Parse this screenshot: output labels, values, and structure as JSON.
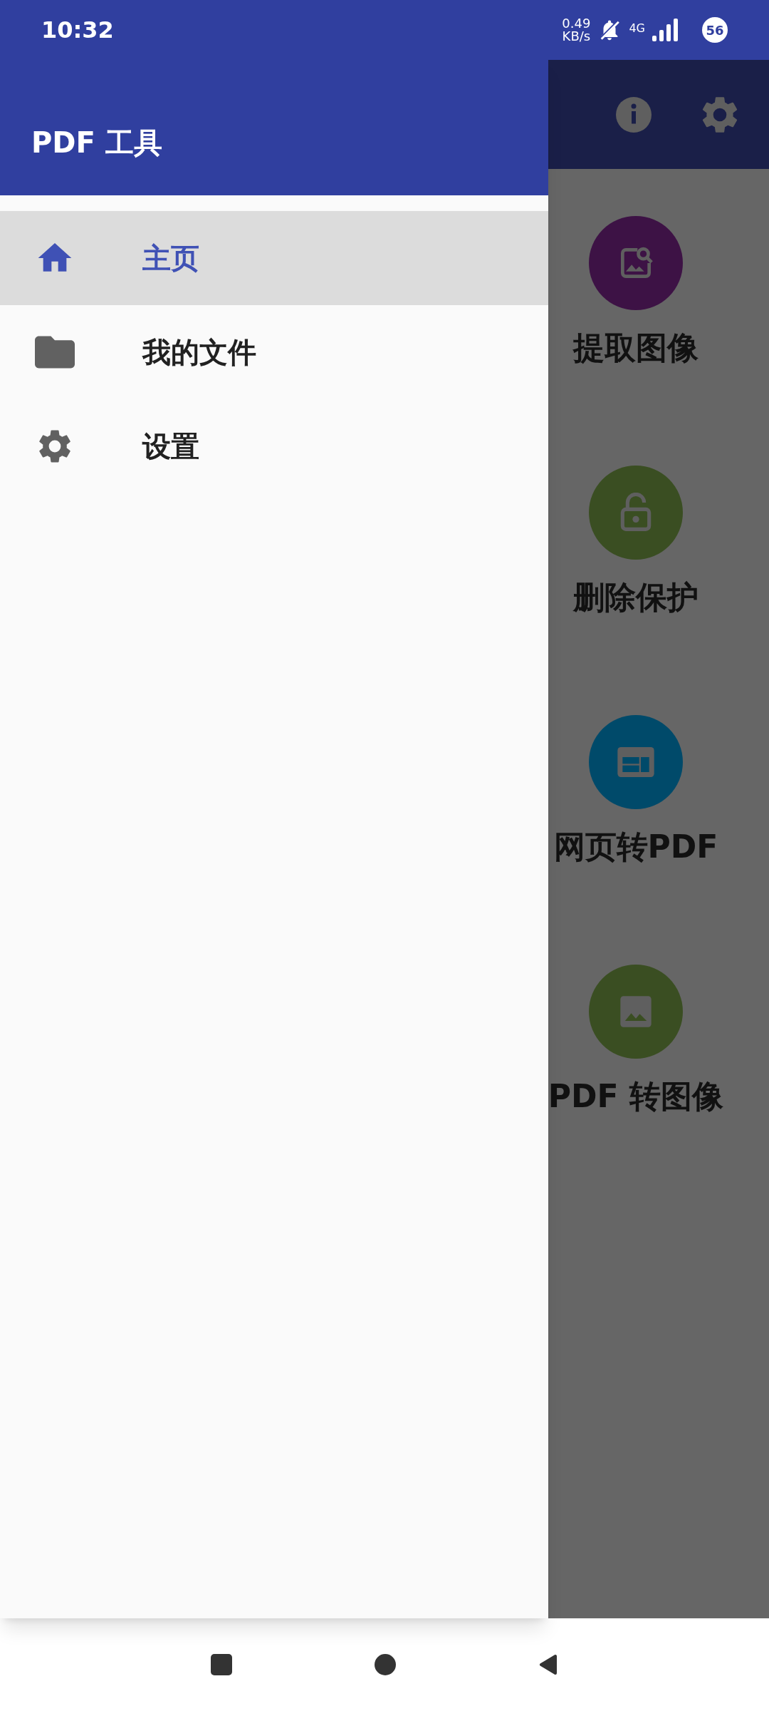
{
  "status_bar": {
    "time": "10:32",
    "net_speed_value": "0.49",
    "net_speed_unit": "KB/s",
    "network": "4G",
    "battery": "56"
  },
  "drawer": {
    "title": "PDF 工具",
    "items": [
      {
        "kind": "home",
        "label": "主页",
        "selected": true
      },
      {
        "kind": "folder",
        "label": "我的文件",
        "selected": false
      },
      {
        "kind": "settings",
        "label": "设置",
        "selected": false
      }
    ]
  },
  "tools": [
    {
      "kind": "extract",
      "label": "提取图像",
      "color": "#3d1245"
    },
    {
      "kind": "unlock",
      "label": "删除保护",
      "color": "#3a4e22"
    },
    {
      "kind": "web",
      "label": "网页转PDF",
      "color": "#004a6a"
    },
    {
      "kind": "image",
      "label": "PDF 转图像",
      "color": "#3a4e22"
    }
  ]
}
